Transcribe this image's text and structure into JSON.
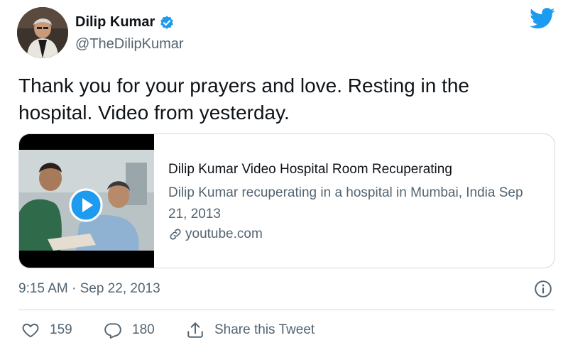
{
  "author": {
    "name": "Dilip Kumar",
    "handle": "@TheDilipKumar",
    "verified": true
  },
  "tweet": {
    "text": "Thank you for your prayers and love. Resting in the hospital. Video from yesterday."
  },
  "card": {
    "title": "Dilip Kumar Video Hospital Room Recuperating",
    "description": "Dilip Kumar recuperating in a hospital in Mumbai, India Sep 21, 2013",
    "domain": "youtube.com",
    "play_icon": "play-icon"
  },
  "meta": {
    "timestamp": "9:15 AM · Sep 22, 2013"
  },
  "actions": {
    "likes": "159",
    "replies": "180",
    "share_label": "Share this Tweet"
  },
  "colors": {
    "brand": "#1d9bf0",
    "text": "#0f1419",
    "muted": "#536471",
    "border": "#cfd9de"
  }
}
